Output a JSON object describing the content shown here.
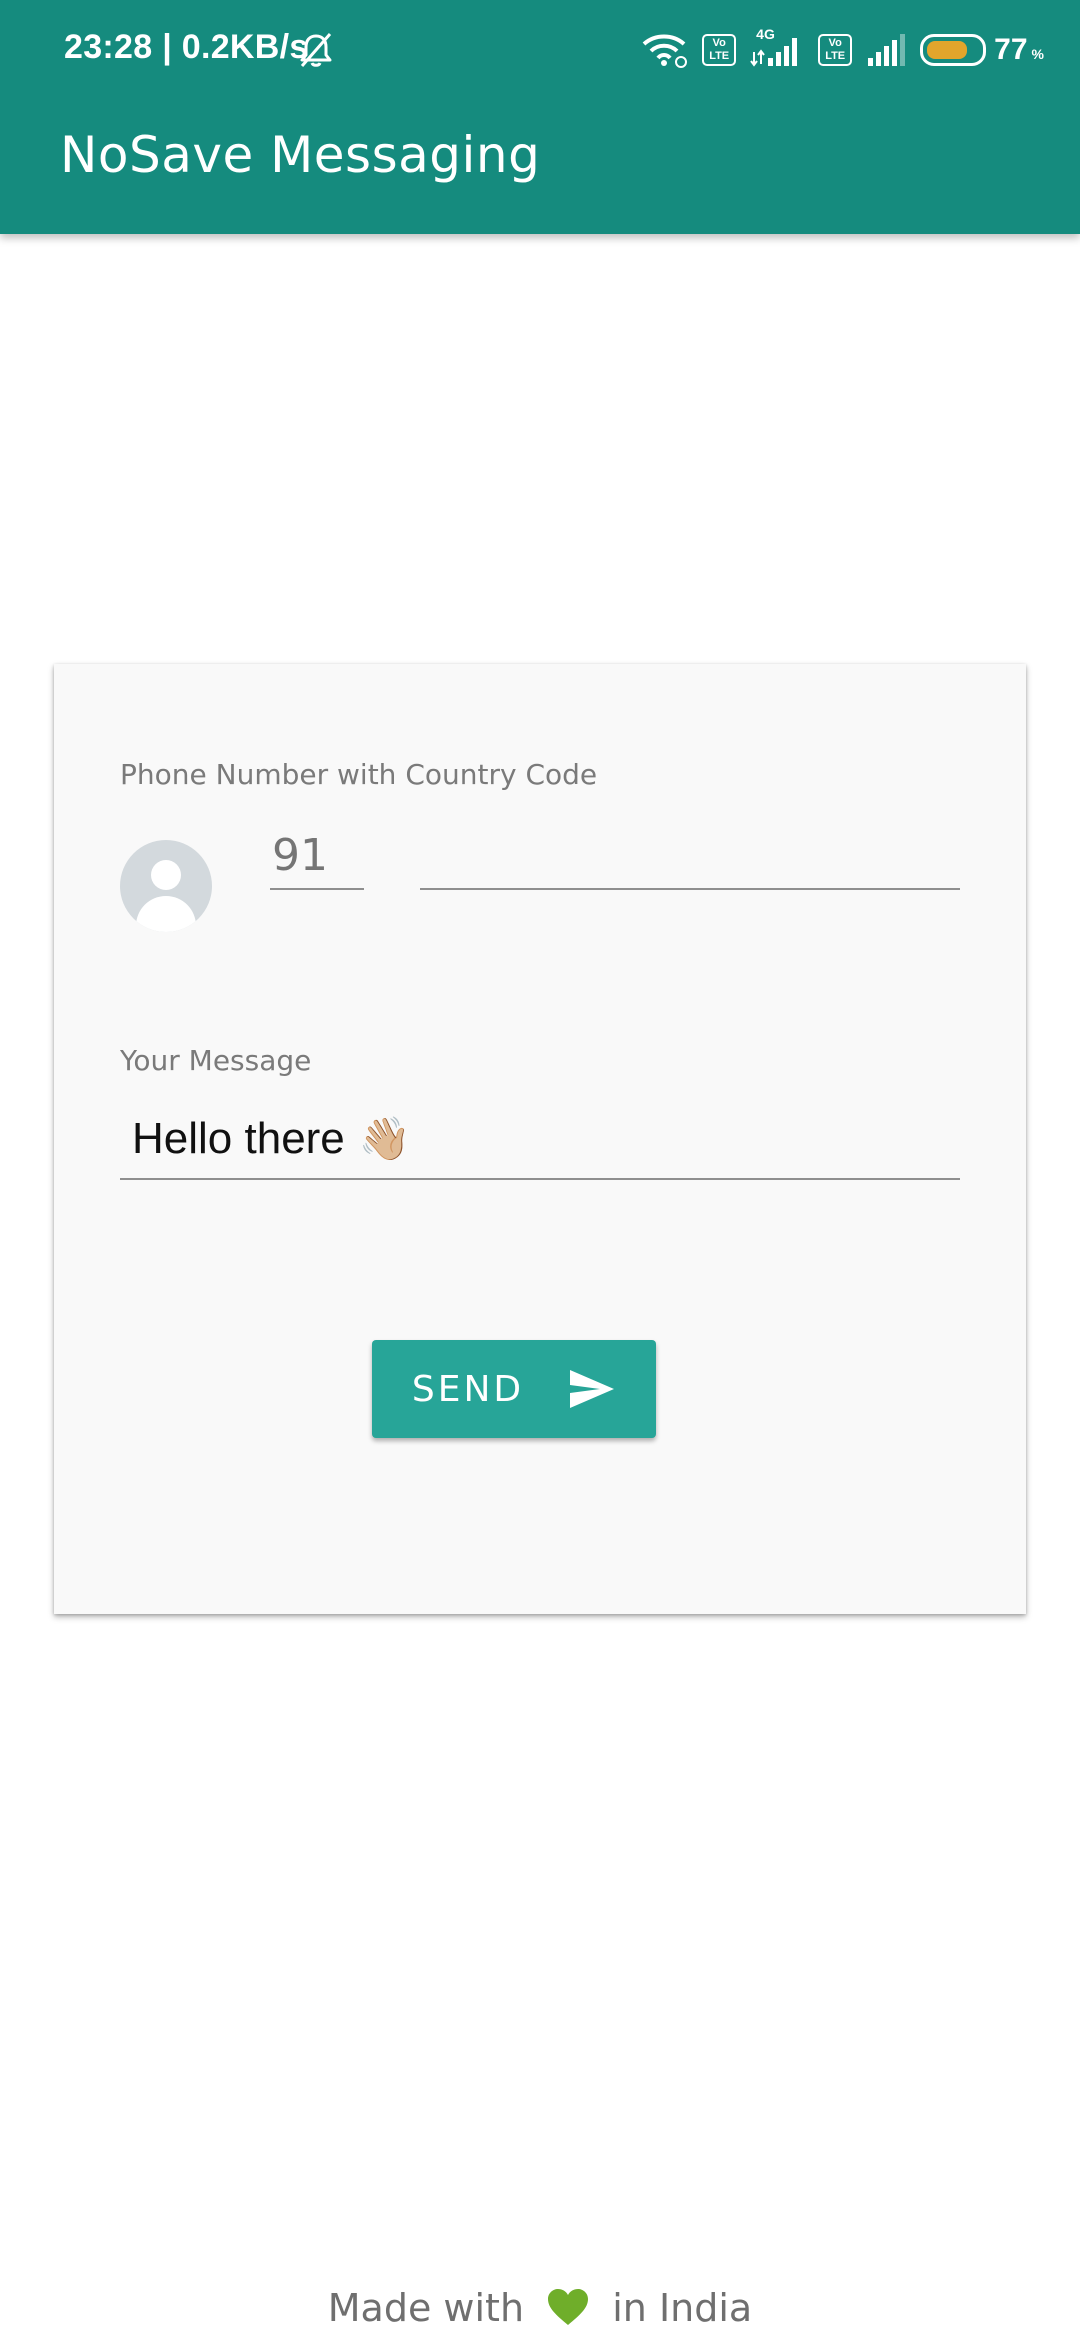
{
  "status_bar": {
    "time": "23:28 | 0.2KB/s",
    "network_type": "4G",
    "volte_label_1": "Vo\nLTE",
    "volte_label_2": "Vo\nLTE",
    "battery_level_percent": 77,
    "battery_text": "77",
    "battery_unit": "%",
    "icons": [
      "bell-off-icon",
      "wifi-icon",
      "volte-icon",
      "signal-icon",
      "battery-icon"
    ]
  },
  "app_bar": {
    "title": "NoSave Messaging"
  },
  "form": {
    "phone_label": "Phone Number with Country Code",
    "country_code_placeholder": "91",
    "phone_value": "",
    "message_label": "Your Message",
    "message_value": "Hello there",
    "message_emoji": "👋🏼",
    "send_label": "SEND",
    "send_icon": "send-icon"
  },
  "footer": {
    "prefix": "Made with",
    "suffix": "in India",
    "heart_icon": "green-heart-icon"
  },
  "colors": {
    "primary": "#158b7e",
    "accent": "#27a598",
    "battery": "#e2a52c",
    "heart": "#6fae2a"
  }
}
